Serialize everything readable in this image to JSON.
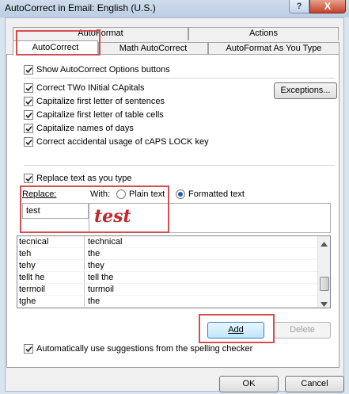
{
  "window": {
    "title": "AutoCorrect in Email: English (U.S.)",
    "help_label": "?",
    "close_label": "X"
  },
  "tabs": {
    "back": [
      {
        "label": "AutoFormat"
      },
      {
        "label": "Actions"
      }
    ],
    "front": [
      {
        "label": "AutoCorrect"
      },
      {
        "label": "Math AutoCorrect"
      },
      {
        "label": "AutoFormat As You Type"
      }
    ],
    "active": "AutoCorrect"
  },
  "options": {
    "show_buttons": {
      "label": "Show AutoCorrect Options buttons",
      "checked": true
    },
    "rules": [
      {
        "label": "Correct TWo INitial CApitals",
        "checked": true
      },
      {
        "label": "Capitalize first letter of sentences",
        "checked": true
      },
      {
        "label": "Capitalize first letter of table cells",
        "checked": true
      },
      {
        "label": "Capitalize names of days",
        "checked": true
      },
      {
        "label": "Correct accidental usage of cAPS LOCK key",
        "checked": true
      }
    ],
    "exceptions_label": "Exceptions..."
  },
  "replace": {
    "checkbox_label": "Replace text as you type",
    "checked": true,
    "replace_label": "Replace:",
    "with_label": "With:",
    "plain_text_label": "Plain text",
    "formatted_text_label": "Formatted text",
    "formatted_selected": true,
    "replace_value": "test",
    "with_value": "test",
    "with_value_color": "#c0282d"
  },
  "entries": [
    {
      "replace": "tecnical",
      "with": "technical"
    },
    {
      "replace": "teh",
      "with": "the"
    },
    {
      "replace": "tehy",
      "with": "they"
    },
    {
      "replace": "tellt he",
      "with": "tell the"
    },
    {
      "replace": "termoil",
      "with": "turmoil"
    },
    {
      "replace": "tghe",
      "with": "the"
    }
  ],
  "buttons": {
    "add": "Add",
    "delete": "Delete",
    "ok": "OK",
    "cancel": "Cancel"
  },
  "suggestions": {
    "label": "Automatically use suggestions from the spelling checker",
    "checked": true
  },
  "colors": {
    "annotation": "#d24f4f",
    "window_frame": "#d9e4f1",
    "radio_dot": "#1e5bb5"
  }
}
